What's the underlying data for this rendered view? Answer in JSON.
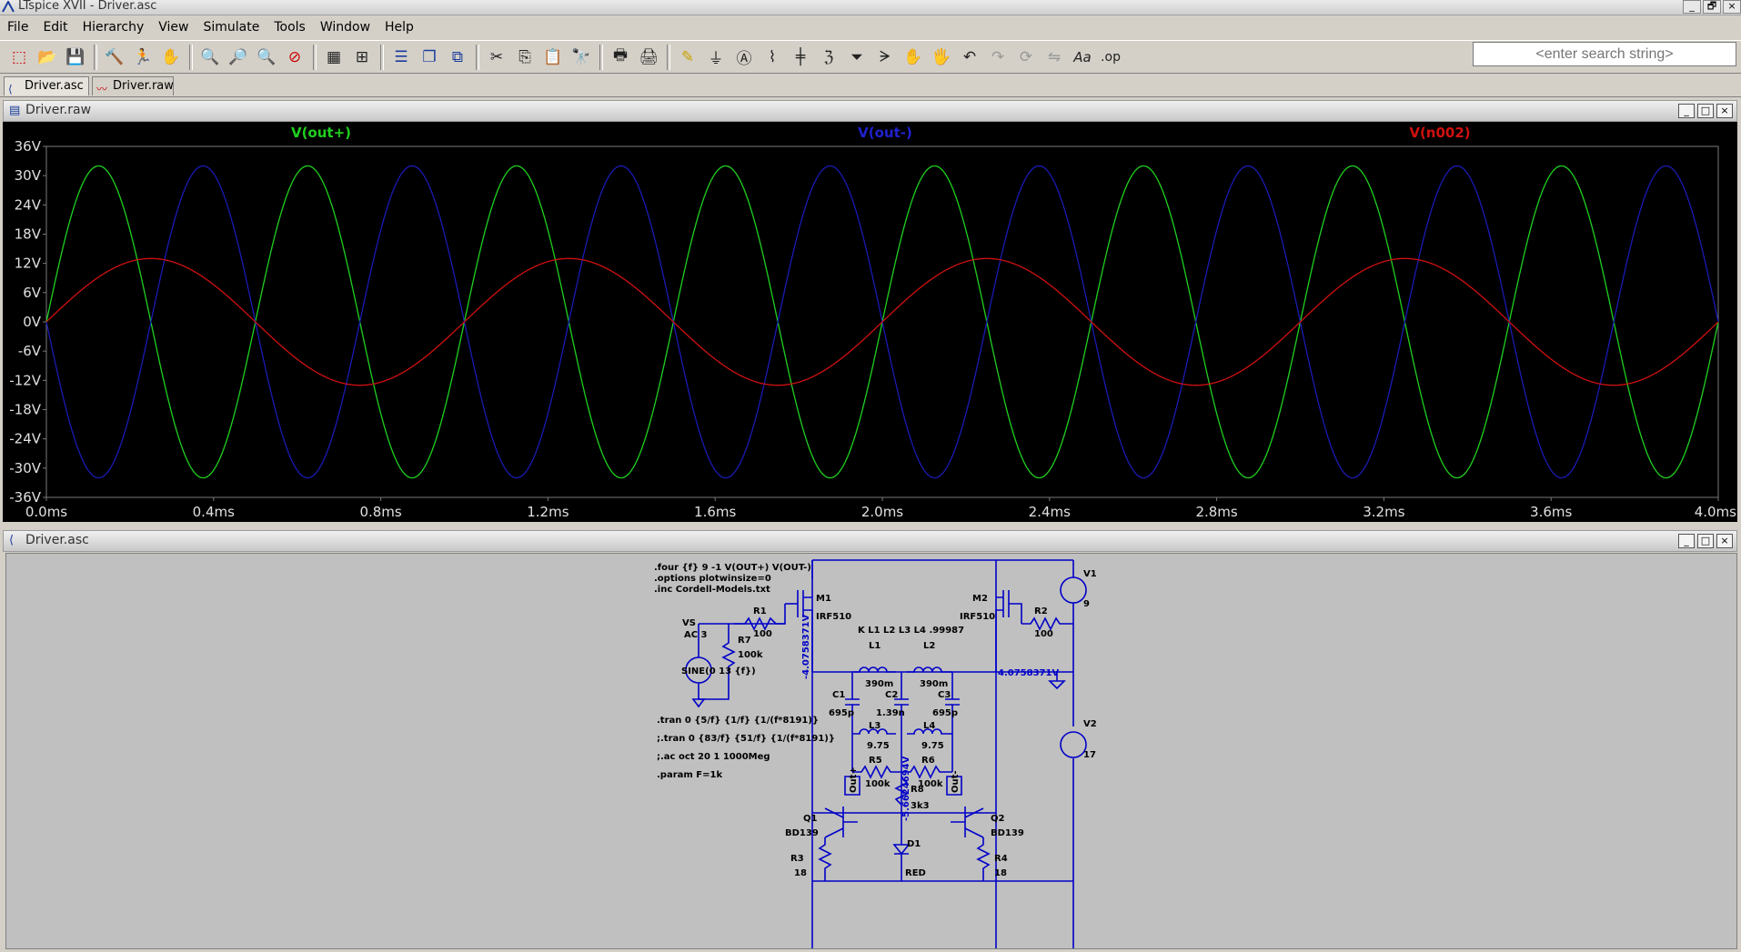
{
  "window": {
    "title": "LTspice XVII - Driver.asc",
    "controls": [
      "_",
      "🗗",
      "×"
    ]
  },
  "menu": [
    "File",
    "Edit",
    "Hierarchy",
    "View",
    "Simulate",
    "Tools",
    "Window",
    "Help"
  ],
  "toolbar": {
    "icons": [
      "new-schematic-icon",
      "open-icon",
      "save-icon",
      "control-panel-icon",
      "run-icon",
      "halt-icon",
      "zoom-in-icon",
      "zoom-box-icon",
      "zoom-out-icon",
      "zoom-cancel-icon",
      "autorange-icon",
      "grid-icon",
      "tile-horizontal-icon",
      "cascade-icon",
      "arrange-icon",
      "cut-icon",
      "copy-icon",
      "paste-icon",
      "find-icon",
      "print-preview-icon",
      "print-icon",
      "draw-wire-icon",
      "ground-icon",
      "label-net-icon",
      "resistor-icon",
      "capacitor-icon",
      "inductor-icon",
      "diode-icon",
      "component-icon",
      "move-icon",
      "drag-icon",
      "undo-icon",
      "redo-icon",
      "rotate-icon",
      "mirror-icon",
      "text-icon",
      "spice-directive-icon"
    ],
    "text_label": "Aa",
    "op_label": ".op"
  },
  "search": {
    "placeholder": "<enter search string>"
  },
  "tabs": [
    {
      "label": "Driver.asc",
      "icon": "schematic-icon"
    },
    {
      "label": "Driver.raw",
      "icon": "waveform-icon"
    }
  ],
  "plot_window": {
    "title": "Driver.raw"
  },
  "schematic_window": {
    "title": "Driver.asc"
  },
  "chart_data": {
    "type": "line",
    "title": "",
    "xlabel": "",
    "ylabel": "",
    "xlim": [
      0,
      4.0
    ],
    "ylim": [
      -36,
      36
    ],
    "x_unit": "ms",
    "y_unit": "V",
    "x_ticks": [
      "0.0ms",
      "0.4ms",
      "0.8ms",
      "1.2ms",
      "1.6ms",
      "2.0ms",
      "2.4ms",
      "2.8ms",
      "3.2ms",
      "3.6ms",
      "4.0ms"
    ],
    "y_ticks": [
      "36V",
      "30V",
      "24V",
      "18V",
      "12V",
      "6V",
      "0V",
      "-6V",
      "-12V",
      "-18V",
      "-24V",
      "-30V",
      "-36V"
    ],
    "grid": false,
    "legend_position": "top",
    "background": "#000000",
    "series": [
      {
        "name": "V(out+)",
        "color": "#1fd01f",
        "amplitude": 32,
        "frequency_khz": 2,
        "phase": "sine"
      },
      {
        "name": "V(out-)",
        "color": "#1a1ab4",
        "amplitude": -32,
        "frequency_khz": 2,
        "phase": "sine"
      },
      {
        "name": "V(n002)",
        "color": "#d01010",
        "amplitude": 13,
        "frequency_khz": 1,
        "phase": "sine"
      }
    ]
  },
  "schematic": {
    "directives": [
      ".four {f} 9 -1 V(OUT+) V(OUT-)",
      ".options plotwinsize=0",
      ".inc Cordell-Models.txt"
    ],
    "sim_lines": [
      ".tran 0 {5/f} {1/f} {1/(f*8191)}",
      ";.tran 0 {83/f} {51/f} {1/(f*8191)}",
      ";.ac oct 20 1 1000Meg",
      ".param F=1k"
    ],
    "coupling": "K L1 L2 L3 L4 .99987",
    "labels": {
      "vs": "VS",
      "vs_ac": "AC 3",
      "vs_sine": "SINE(0 13 {f})",
      "r1": "R1",
      "r1v": "100",
      "r7": "R7",
      "r7v": "100k",
      "m1": "M1",
      "m1v": "IRF510",
      "m2": "M2",
      "m2v": "IRF510",
      "r2": "R2",
      "r2v": "100",
      "v1": "V1",
      "v1v": "9",
      "v2": "V2",
      "v2v": "17",
      "l1": "L1",
      "l1v": "390m",
      "l2": "L2",
      "l2v": "390m",
      "c1": "C1",
      "c1v": "695p",
      "c2": "C2",
      "c2v": "1.39n",
      "c3": "C3",
      "c3v": "695p",
      "l3": "L3",
      "l3v": "9.75",
      "l4": "L4",
      "l4v": "9.75",
      "r5": "R5",
      "r5v": "100k",
      "r6": "R6",
      "r6v": "100k",
      "r8": "R8",
      "r8v": "3k3",
      "q1": "Q1",
      "q1v": "BD139",
      "q2": "Q2",
      "q2v": "BD139",
      "r3": "R3",
      "r3v": "18",
      "r4": "R4",
      "r4v": "18",
      "d1": "D1",
      "d1v": "RED",
      "out_plus": "Out+",
      "out_minus": "Out-",
      "op_left": "-4.0758371V",
      "op_right": "4.0758371V",
      "op_mid": "-5.6624694V"
    }
  }
}
